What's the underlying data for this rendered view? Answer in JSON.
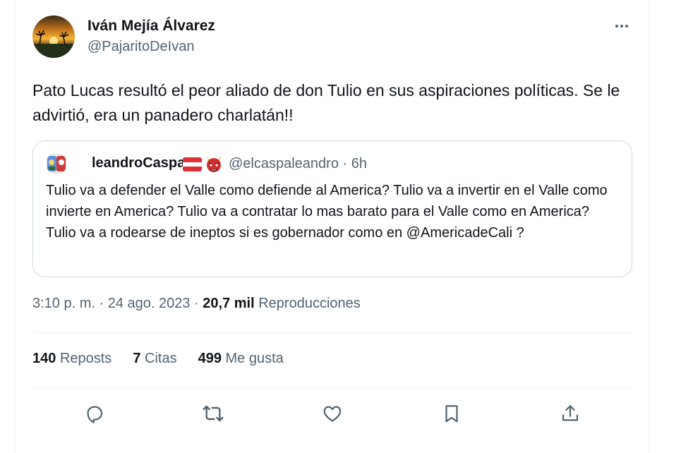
{
  "author": {
    "name": "Iván Mejía Álvarez",
    "handle": "@PajaritoDeIvan"
  },
  "tweet_text": "Pato Lucas resultó el peor aliado de don Tulio en sus aspiraciones políticas. Se le advirtió, era un panadero charlatán!!",
  "quote": {
    "name": "leandroCaspa",
    "handle_time": "@elcaspaleandro · 6h",
    "text": "Tulio va a defender el Valle como defiende al America? Tulio va a invertir en el Valle como invierte en America? Tulio va a contratar lo mas barato para el Valle como en America? Tulio va a rodearse de ineptos si es gobernador como en @AmericadeCali ?",
    "flag_icon": "austria-flag-icon",
    "emoji_icon": "red-demon-mask-icon"
  },
  "meta": {
    "time_date": "3:10 p. m. · 24 ago. 2023 ·",
    "views_count": "20,7 mil",
    "views_label": "Reproducciones"
  },
  "stats": {
    "reposts_count": "140",
    "reposts_label": "Reposts",
    "quotes_count": "7",
    "quotes_label": "Citas",
    "likes_count": "499",
    "likes_label": "Me gusta"
  },
  "actions": [
    "reply-icon",
    "retweet-icon",
    "like-icon",
    "bookmark-icon",
    "share-icon"
  ],
  "colors": {
    "text": "#0f1419",
    "secondary": "#536471",
    "border": "#cfd9de",
    "divider": "#eff3f4"
  }
}
